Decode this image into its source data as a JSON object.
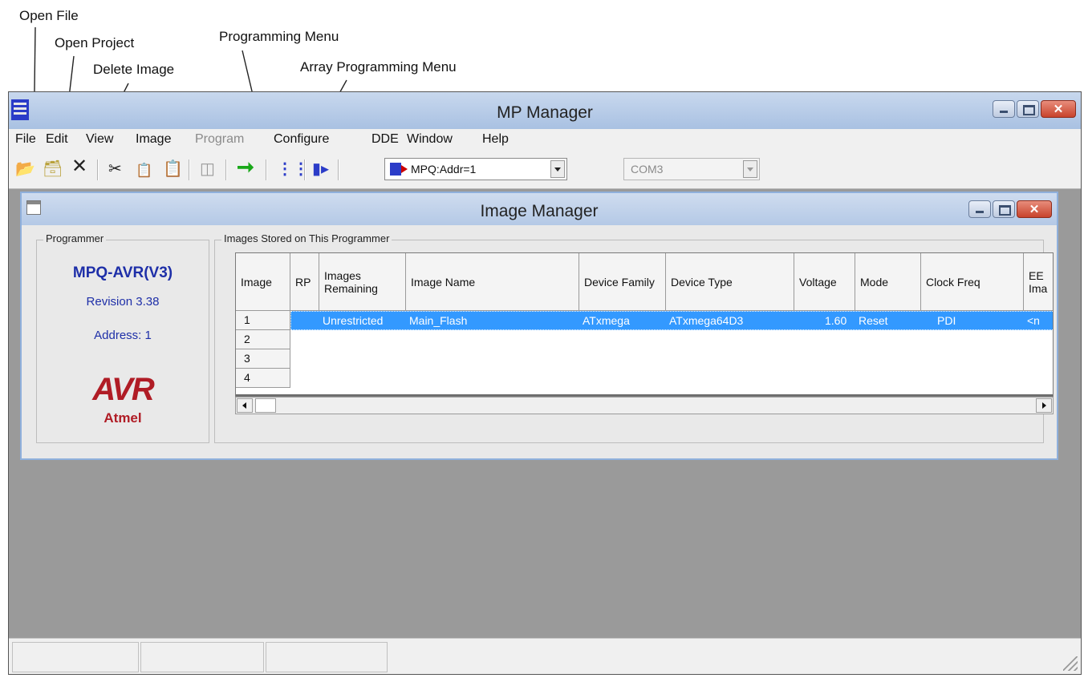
{
  "callouts": {
    "open_file": "Open File",
    "open_project": "Open Project",
    "delete_image": "Delete Image",
    "programming_menu": "Programming Menu",
    "array_programming_menu": "Array Programming Menu"
  },
  "app": {
    "title": "MP Manager",
    "menu": [
      "File",
      "Edit",
      "View",
      "Image",
      "Program",
      "Configure",
      "DDE",
      "Window",
      "Help"
    ],
    "toolbar": {
      "device_select": "MPQ:Addr=1",
      "port_select": "COM3"
    }
  },
  "image_manager": {
    "title": "Image Manager",
    "programmer": {
      "group_label": "Programmer",
      "name": "MPQ-AVR(V3)",
      "revision": "Revision 3.38",
      "address": "Address: 1",
      "logo_main": "AVR",
      "logo_sub": "Atmel"
    },
    "images": {
      "group_label": "Images Stored on This Programmer",
      "columns": [
        "Image",
        "RP",
        "Images Remaining",
        "Image Name",
        "Device Family",
        "Device Type",
        "Voltage",
        "Mode",
        "Clock Freq",
        "EE Ima"
      ],
      "row_numbers": [
        "1",
        "2",
        "3",
        "4"
      ],
      "selected_row": {
        "images_remaining": "Unrestricted",
        "image_name": "Main_Flash",
        "device_family": "ATxmega",
        "device_type": "ATxmega64D3",
        "voltage": "1.60",
        "mode": "Reset",
        "clock_freq": "PDI",
        "ee_image": "<n"
      }
    }
  },
  "colors": {
    "selection": "#3399ff",
    "programmer_text": "#1e2fa8",
    "logo_red": "#b01c25",
    "mdi_background": "#9a9a9a"
  }
}
